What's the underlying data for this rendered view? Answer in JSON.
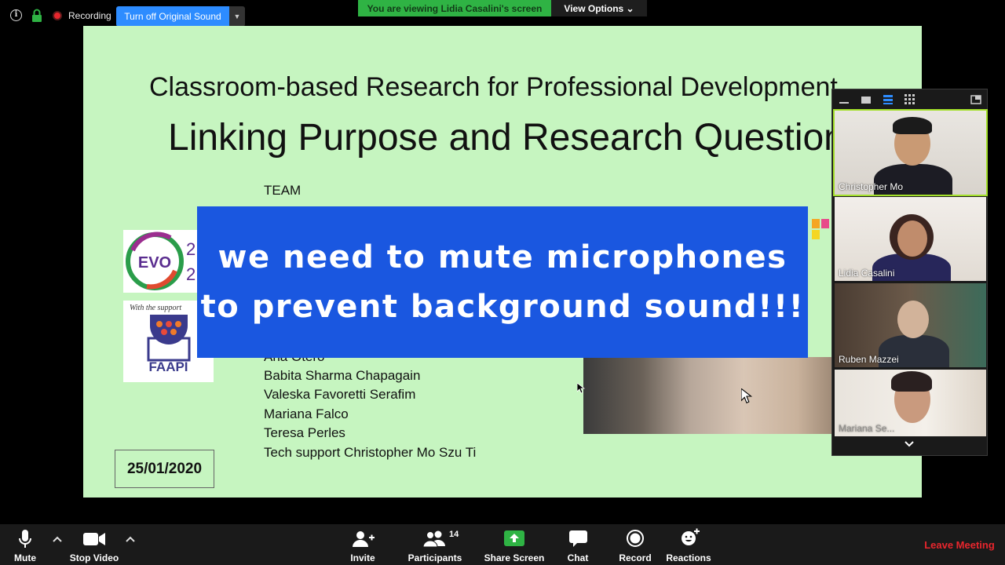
{
  "top_bar": {
    "recording_label": "Recording",
    "original_sound_button": "Turn off Original Sound",
    "viewing_banner": "You are viewing Lidia Casalini's screen",
    "view_options": "View Options ⌄",
    "colors": {
      "accent": "#2d8cff",
      "banner": "#2fb344",
      "recording": "#e8262d"
    }
  },
  "slide": {
    "title": "Classroom-based Research for Professional Development",
    "subtitle": "Linking Purpose and Research Questions",
    "team_label": "TEAM",
    "members": [
      "Ana Otero",
      "Babita Sharma Chapagain",
      "Valeska Favoretti Serafim",
      "Mariana Falco",
      "Teresa Perles",
      "Tech support Christopher Mo Szu Ti"
    ],
    "evo_logo_text": "EVO",
    "evo_logo_digits": [
      "2",
      "2"
    ],
    "support_text": "With the support",
    "faapi_logo_text": "FAAPI",
    "date": "25/01/2020",
    "background": "#c6f5c0"
  },
  "overlay": {
    "line1": "we need to mute microphones",
    "line2": "to prevent background sound!!!",
    "background": "#1a57e0"
  },
  "gallery": {
    "participants": [
      {
        "name": "Christopher Mo",
        "active": true
      },
      {
        "name": "Lidia Casalini",
        "active": false
      },
      {
        "name": "Ruben Mazzei",
        "active": false
      },
      {
        "name": "Mariana Se...",
        "active": false
      }
    ]
  },
  "toolbar": {
    "mute": "Mute",
    "stop_video": "Stop Video",
    "invite": "Invite",
    "participants": "Participants",
    "participants_count": "14",
    "share_screen": "Share Screen",
    "chat": "Chat",
    "record": "Record",
    "reactions": "Reactions",
    "leave": "Leave Meeting",
    "colors": {
      "share": "#2fb344",
      "leave": "#e8262d"
    }
  }
}
